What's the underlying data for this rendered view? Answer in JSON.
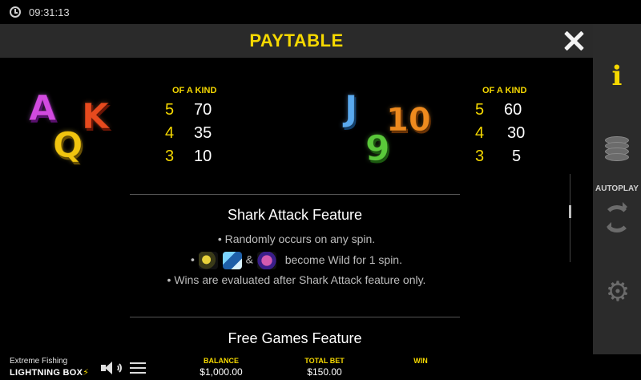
{
  "status": {
    "time": "09:31:13"
  },
  "paytable": {
    "title": "PAYTABLE",
    "group1": {
      "symbols": [
        "A",
        "K",
        "Q"
      ],
      "header": "OF A KIND",
      "rows": [
        {
          "count": "5",
          "pay": "70"
        },
        {
          "count": "4",
          "pay": "35"
        },
        {
          "count": "3",
          "pay": "10"
        }
      ]
    },
    "group2": {
      "symbols": [
        "J",
        "10",
        "9"
      ],
      "header": "OF A KIND",
      "rows": [
        {
          "count": "5",
          "pay": "60"
        },
        {
          "count": "4",
          "pay": "30"
        },
        {
          "count": "3",
          "pay": "5"
        }
      ]
    },
    "shark_feature": {
      "title": "Shark Attack Feature",
      "bullet1": "• Randomly occurs on any spin.",
      "bullet2_prefix": "•",
      "bullet2_amp": "&",
      "bullet2_suffix": "become Wild for 1 spin.",
      "bullet3": "• Wins are evaluated after Shark Attack feature only."
    },
    "free_games": {
      "title": "Free Games Feature"
    }
  },
  "sidebar": {
    "info_label": "i",
    "autoplay_label": "AUTOPLAY",
    "settings_glyph": "⚙"
  },
  "bottom": {
    "game_name": "Extreme Fishing",
    "brand": "LIGHTNING BOX",
    "balance_label": "BALANCE",
    "balance_value": "$1,000.00",
    "total_bet_label": "TOTAL BET",
    "total_bet_value": "$150.00",
    "win_label": "WIN",
    "win_value": ""
  },
  "colors": {
    "accent": "#f5d800",
    "panel": "#2a2a2a",
    "sidebar": "#2b2b2b"
  }
}
